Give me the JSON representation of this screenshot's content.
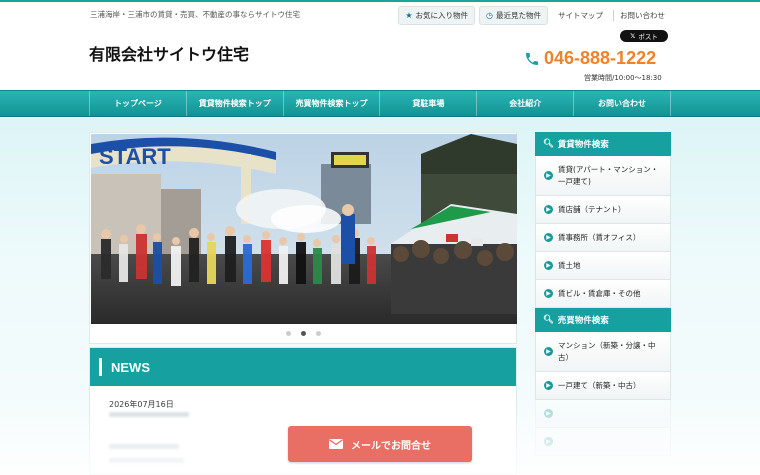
{
  "header": {
    "tagline": "三浦海岸・三浦市の賃貸・売買、不動産の事ならサイトウ住宅",
    "company_name": "有限会社サイトウ住宅",
    "favorites_label": "お気に入り物件",
    "recent_label": "最近見た物件",
    "sitemap_label": "サイトマップ",
    "contact_label": "お問い合わせ",
    "post_button": "ポスト",
    "phone": "046-888-1222",
    "hours": "営業時間/10:00～18:30"
  },
  "nav": {
    "items": [
      {
        "label": "トップページ"
      },
      {
        "label": "賃貸物件検索トップ"
      },
      {
        "label": "売買物件検索トップ"
      },
      {
        "label": "貸駐車場"
      },
      {
        "label": "会社紹介"
      },
      {
        "label": "お問い合わせ"
      }
    ]
  },
  "slider": {
    "banner_text": "START",
    "slide_count": 3,
    "active_index": 1
  },
  "news": {
    "title": "NEWS",
    "date": "2026年07月16日"
  },
  "sidebar": {
    "rental_title": "賃貸物件検索",
    "rental_items": [
      {
        "label": "賃貸(アパート・マンション・一戸建て)"
      },
      {
        "label": "賃店舗（テナント）"
      },
      {
        "label": "賃事務所（賃オフィス）"
      },
      {
        "label": "賃土地"
      },
      {
        "label": "賃ビル・賃倉庫・その他"
      }
    ],
    "sale_title": "売買物件検索",
    "sale_items": [
      {
        "label": "マンション（新築・分譲・中古）"
      },
      {
        "label": "一戸建て（新築・中古）"
      }
    ]
  },
  "cta": {
    "mail_label": "メールでお問合せ"
  },
  "colors": {
    "accent": "#16a0a0",
    "phone": "#f0822a",
    "cta": "#e96e63"
  }
}
